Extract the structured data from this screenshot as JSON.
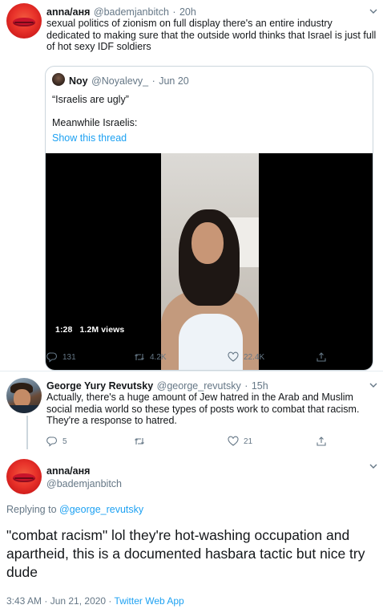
{
  "tweet1": {
    "name": "anna/аня",
    "handle": "@bademjanbitch",
    "time": "20h",
    "text": "sexual politics of zionism on full display there's an entire industry dedicated to making sure that the outside world thinks that Israel is just full of hot sexy IDF soldiers",
    "quote": {
      "name": "Noy",
      "handle": "@Noyalevy_",
      "date": "Jun 20",
      "line1": "“Israelis are ugly”",
      "line2": "Meanwhile Israelis:",
      "show_thread": "Show this thread",
      "video_time": "1:28",
      "video_views": "1.2M views"
    },
    "stats": {
      "replies": "131",
      "retweets": "4.2K",
      "likes": "22.4K"
    }
  },
  "tweet2": {
    "name": "George Yury Revutsky",
    "handle": "@george_revutsky",
    "time": "15h",
    "text": "Actually, there's a huge amount of Jew hatred in the Arab and Muslim social media world so these types of posts work to combat that racism. They're a response to hatred.",
    "stats": {
      "replies": "5",
      "retweets": "",
      "likes": "21"
    }
  },
  "main": {
    "name": "anna/аня",
    "handle": "@bademjanbitch",
    "replying_label": "Replying to",
    "replying_handle": "@george_revutsky",
    "text": "\"combat racism\" lol they're hot-washing occupation and apartheid, this is a documented hasbara tactic but nice try dude",
    "timestamp": "3:43 AM · Jun 21, 2020 ·",
    "client": "Twitter Web App"
  },
  "sep": "·",
  "colors": {
    "accent": "#1da1f2",
    "secondary": "#657786",
    "border": "#ccd6dd"
  }
}
